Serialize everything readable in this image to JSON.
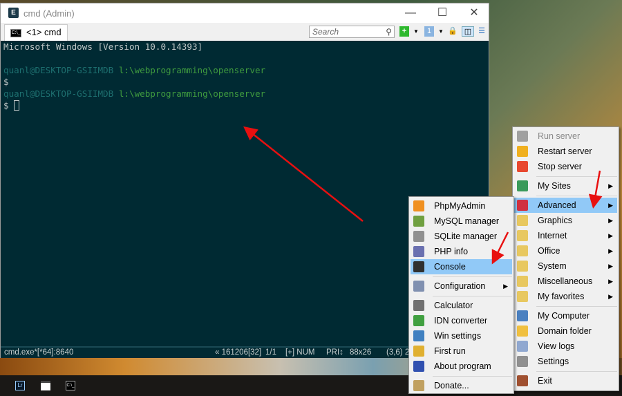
{
  "window": {
    "title": "cmd (Admin)",
    "tab_label": "<1> cmd",
    "search_placeholder": "Search",
    "icon_label": "C:\\_"
  },
  "console": {
    "lines": [
      {
        "text": "Microsoft Windows [Version 10.0.14393]"
      },
      {
        "text": ""
      },
      {
        "user": "quanl@DESKTOP-GSIIMDB",
        "path": " l:\\webprogramming\\openserver"
      },
      {
        "text": "$"
      },
      {
        "user": "quanl@DESKTOP-GSIIMDB",
        "path": " l:\\webprogramming\\openserver"
      },
      {
        "text": "$ ",
        "cursor": true
      }
    ]
  },
  "status": {
    "process": "cmd.exe*[*64]:8640",
    "info": "« 161206[32]",
    "page": "1/1",
    "mode": "[+] NUM",
    "pri": "PRI↕",
    "size": "88x26",
    "pos": "(3,6) 2"
  },
  "taskbar": {
    "items": [
      "Lr",
      "clapper",
      "C:\\_"
    ]
  },
  "main_menu": {
    "items": [
      {
        "label": "Run server",
        "icon": "flag-gray-icon",
        "color": "#a0a0a0",
        "disabled": true
      },
      {
        "label": "Restart server",
        "icon": "flag-yellow-icon",
        "color": "#f0b020"
      },
      {
        "label": "Stop server",
        "icon": "flag-red-icon",
        "color": "#e84830"
      },
      {
        "sep": true
      },
      {
        "label": "My Sites",
        "icon": "globe-icon",
        "color": "#3a9a5a",
        "sub": true
      },
      {
        "sep": true
      },
      {
        "label": "Advanced",
        "icon": "blocks-icon",
        "color": "#d03040",
        "sub": true,
        "highlight": true
      },
      {
        "label": "Graphics",
        "icon": "folder-icon",
        "color": "#e8c860",
        "sub": true
      },
      {
        "label": "Internet",
        "icon": "folder-icon",
        "color": "#e8c860",
        "sub": true
      },
      {
        "label": "Office",
        "icon": "folder-icon",
        "color": "#e8c860",
        "sub": true
      },
      {
        "label": "System",
        "icon": "folder-icon",
        "color": "#e8c860",
        "sub": true
      },
      {
        "label": "Miscellaneous",
        "icon": "folder-icon",
        "color": "#e8c860",
        "sub": true
      },
      {
        "label": "My favorites",
        "icon": "folder-icon",
        "color": "#e8c860",
        "sub": true
      },
      {
        "sep": true
      },
      {
        "label": "My Computer",
        "icon": "computer-icon",
        "color": "#4a80c0"
      },
      {
        "label": "Domain folder",
        "icon": "folder-icon",
        "color": "#f0c040"
      },
      {
        "label": "View logs",
        "icon": "notepad-icon",
        "color": "#90a8d0"
      },
      {
        "label": "Settings",
        "icon": "gear-icon",
        "color": "#909090"
      },
      {
        "sep": true
      },
      {
        "label": "Exit",
        "icon": "door-icon",
        "color": "#a05030"
      }
    ]
  },
  "sub_menu": {
    "items": [
      {
        "label": "PhpMyAdmin",
        "icon": "phpmyadmin-icon",
        "color": "#f09020"
      },
      {
        "label": "MySQL manager",
        "icon": "heidisql-icon",
        "color": "#70a040"
      },
      {
        "label": "SQLite manager",
        "icon": "database-icon",
        "color": "#909090"
      },
      {
        "label": "PHP info",
        "icon": "php-icon",
        "color": "#6a70b0"
      },
      {
        "label": "Console",
        "icon": "console-icon",
        "color": "#303030",
        "highlight": true
      },
      {
        "sep": true
      },
      {
        "label": "Configuration",
        "icon": "wrench-icon",
        "color": "#8090b0",
        "sub": true
      },
      {
        "sep": true
      },
      {
        "label": "Calculator",
        "icon": "calculator-icon",
        "color": "#707070"
      },
      {
        "label": "IDN converter",
        "icon": "convert-icon",
        "color": "#40a040"
      },
      {
        "label": "Win settings",
        "icon": "win-settings-icon",
        "color": "#4080c0"
      },
      {
        "label": "First run",
        "icon": "first-run-icon",
        "color": "#e0b030"
      },
      {
        "label": "About program",
        "icon": "info-icon",
        "color": "#3050b0"
      },
      {
        "sep": true
      },
      {
        "label": "Donate...",
        "icon": "donate-icon",
        "color": "#c0a060"
      }
    ]
  },
  "colors": {
    "highlight": "#91c9f7",
    "console_bg": "#002a33",
    "arrow": "#e81010"
  }
}
